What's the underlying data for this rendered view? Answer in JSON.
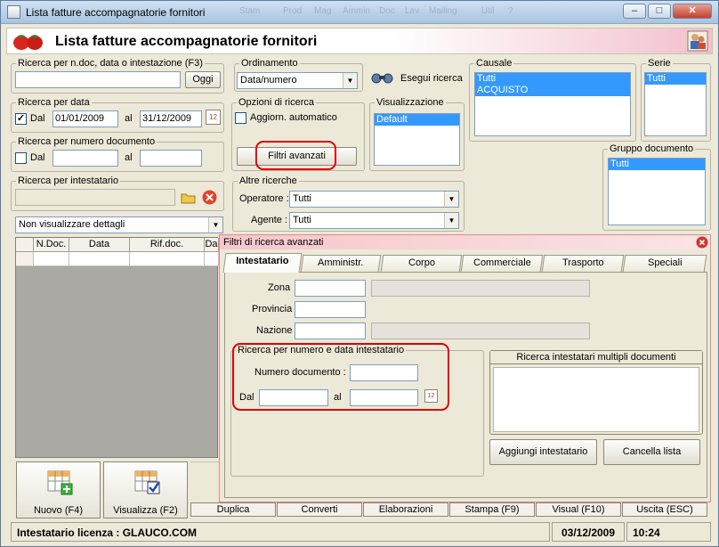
{
  "window": {
    "title": "Lista fatture accompagnatorie fornitori",
    "bg_menu": [
      "Stam",
      "Prod",
      "Mag",
      "Ammin",
      "Doc",
      "Lav",
      "Mailing",
      "Util",
      "?"
    ],
    "min": "–",
    "max": "□",
    "close": "✕"
  },
  "header": {
    "title": "Lista fatture accompagnatorie fornitori"
  },
  "search_text": {
    "legend": "Ricerca per n.doc, data o intestazione (F3)",
    "value": "",
    "today_button": "Oggi"
  },
  "search_date": {
    "legend": "Ricerca per data",
    "checkbox_label": "Dal",
    "checked": true,
    "from": "01/01/2009",
    "to_label": "al",
    "to": "31/12/2009"
  },
  "search_docnum": {
    "legend": "Ricerca per numero documento",
    "checkbox_label": "Dal",
    "checked": false,
    "from": "",
    "to_label": "al",
    "to": ""
  },
  "search_holder": {
    "legend": "Ricerca per intestatario",
    "value": ""
  },
  "details_select": {
    "value": "Non visualizzare dettagli"
  },
  "ordering": {
    "legend": "Ordinamento",
    "value": "Data/numero"
  },
  "run_search": {
    "label": "Esegui ricerca"
  },
  "search_options": {
    "legend": "Opzioni di ricerca",
    "auto_update_label": "Aggiorn. automatico",
    "auto_update": false,
    "advanced_filters_button": "Filtri avanzati"
  },
  "view": {
    "legend": "Visualizzazione",
    "items": [
      "Default"
    ]
  },
  "causale": {
    "legend": "Causale",
    "items": [
      "Tutti",
      "ACQUISTO"
    ]
  },
  "serie": {
    "legend": "Serie",
    "items": [
      "Tutti"
    ]
  },
  "doc_group": {
    "legend": "Gruppo documento",
    "items": [
      "Tutti"
    ]
  },
  "other_searches": {
    "legend": "Altre ricerche",
    "operator_label": "Operatore :",
    "operator_value": "Tutti",
    "agent_label": "Agente :",
    "agent_value": "Tutti"
  },
  "grid": {
    "columns": [
      "N.Doc.",
      "Data",
      "Rif.doc.",
      "Da"
    ]
  },
  "advanced_dialog": {
    "title": "Filtri di ricerca avanzati",
    "tabs": [
      "Intestatario",
      "Amministr.",
      "Corpo",
      "Commerciale",
      "Trasporto",
      "Speciali"
    ],
    "zone_label": "Zona",
    "province_label": "Provincia",
    "nation_label": "Nazione",
    "numdate_group": {
      "legend": "Ricerca per numero e data intestatario",
      "docnum_label": "Numero documento :",
      "from_label": "Dal",
      "to_label": "al"
    },
    "multi_group": {
      "legend": "Ricerca intestatari multipli documenti"
    },
    "add_button": "Aggiungi intestatario",
    "clear_button": "Cancella lista"
  },
  "bottom_buttons": {
    "new": "Nuovo (F4)",
    "view": "Visualizza (F2)",
    "duplicate": "Duplica",
    "convert": "Converti",
    "process": "Elaborazioni",
    "print": "Stampa (F9)",
    "visual": "Visual (F10)",
    "exit": "Uscita (ESC)"
  },
  "status": {
    "license": "Intestatario licenza : GLAUCO.COM",
    "date": "03/12/2009",
    "time": "10:24"
  },
  "colors": {
    "selection": "#3399ff",
    "highlight": "#e00000"
  }
}
